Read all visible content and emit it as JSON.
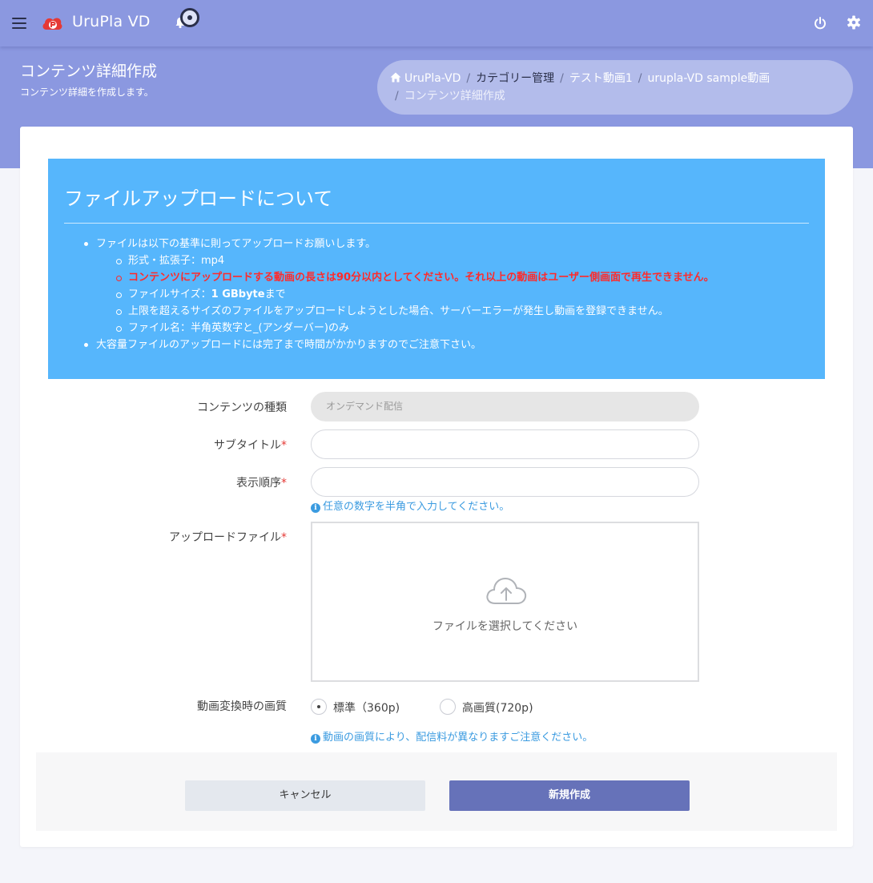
{
  "app": {
    "brand": "UruPla VD"
  },
  "icons": {
    "menu": "hamburger-icon",
    "logo": "urupla-logo",
    "notifications": "bell-icon",
    "power": "power-icon",
    "settings": "gear-icon",
    "home": "home-icon",
    "upload": "cloud-upload-icon",
    "info": "info-circle-icon"
  },
  "colors": {
    "header": "#8b98e0",
    "info_box": "#56b6fc",
    "warning": "#ff2a2a",
    "primary_button": "#6672b9",
    "help_text": "#3b9be0"
  },
  "page": {
    "title": "コンテンツ詳細作成",
    "subtitle": "コンテンツ詳細を作成します。"
  },
  "breadcrumb": {
    "items": [
      "UruPla-VD",
      "カテゴリー管理",
      "テスト動画1",
      "urupla-VD sample動画",
      "コンテンツ詳細作成"
    ],
    "separator": "/"
  },
  "info": {
    "title": "ファイルアップロードについて",
    "item1": "ファイルは以下の基準に則ってアップロードお願いします。",
    "sub1": "形式・拡張子：mp4",
    "sub2_warning": "コンテンツにアップロードする動画の長さは90分以内としてください。それ以上の動画はユーザー側画面で再生できません。",
    "sub3_prefix": "ファイルサイズ：",
    "sub3_bold": "1 GBbyte",
    "sub3_suffix": "まで",
    "sub4": "上限を超えるサイズのファイルをアップロードしようとした場合、サーバーエラーが発生し動画を登録できません。",
    "sub5": "ファイル名：半角英数字と_(アンダーバー)のみ",
    "item2": "大容量ファイルのアップロードには完了まで時間がかかりますのでご注意下さい。"
  },
  "form": {
    "content_type": {
      "label": "コンテンツの種類",
      "value": "オンデマンド配信"
    },
    "subtitle": {
      "label": "サブタイトル",
      "required": "*",
      "value": ""
    },
    "order": {
      "label": "表示順序",
      "required": "*",
      "value": "",
      "help": "任意の数字を半角で入力してください。"
    },
    "upload": {
      "label": "アップロードファイル",
      "required": "*",
      "prompt": "ファイルを選択してください"
    },
    "quality": {
      "label": "動画変換時の画質",
      "options": [
        {
          "label": "標準（360p)",
          "checked": true
        },
        {
          "label": "高画質(720p)",
          "checked": false
        }
      ],
      "help": "動画の画質により、配信料が異なりますご注意ください。"
    }
  },
  "buttons": {
    "cancel": "キャンセル",
    "create": "新規作成"
  }
}
